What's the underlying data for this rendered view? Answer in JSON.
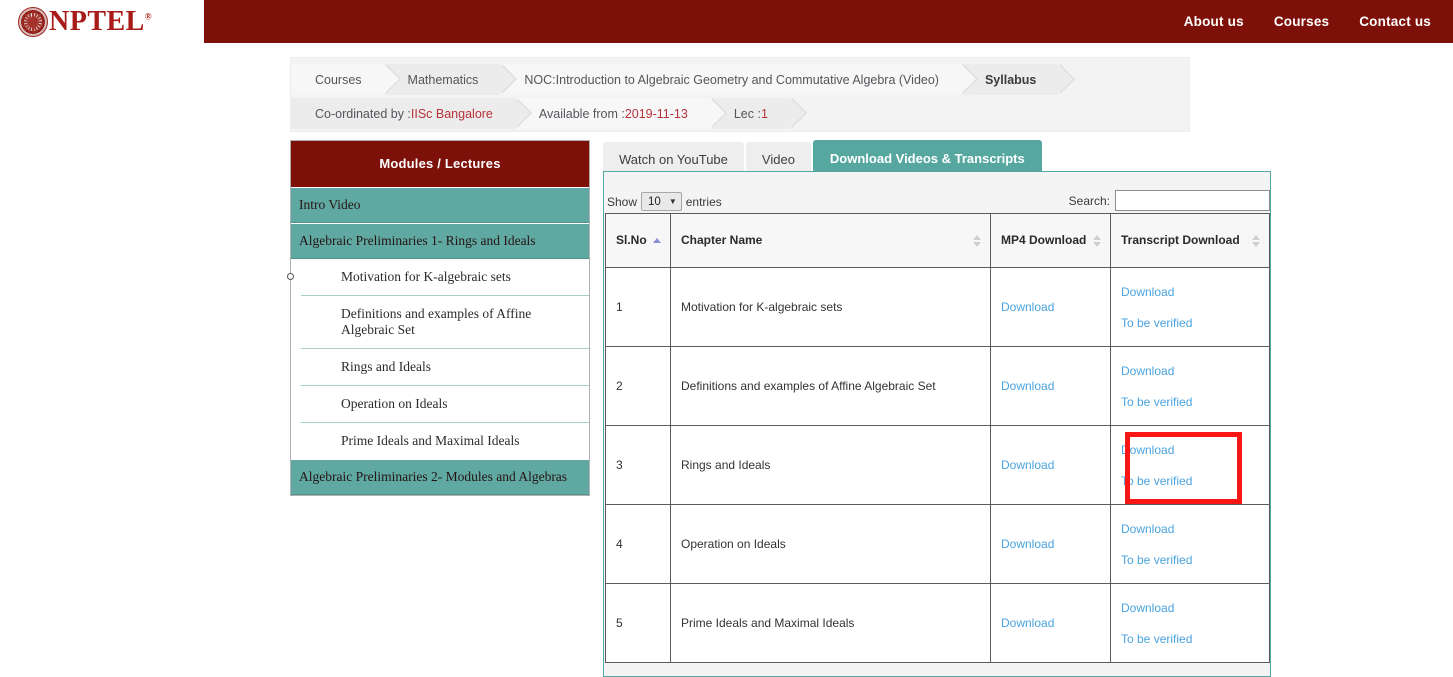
{
  "brand": {
    "logo_text": "NPTEL",
    "logo_trademark": "®",
    "bar_color": "#7d1008"
  },
  "topnav": {
    "items": [
      {
        "label": "About us"
      },
      {
        "label": "Courses"
      },
      {
        "label": "Contact us"
      }
    ]
  },
  "breadcrumb": {
    "row1": [
      {
        "label": "Courses"
      },
      {
        "label": "Mathematics"
      },
      {
        "label": "NOC:Introduction to Algebraic Geometry and Commutative Algebra (Video)"
      },
      {
        "label": "Syllabus"
      }
    ],
    "row2": [
      {
        "prefix": "Co-ordinated by : ",
        "accent": "IISc Bangalore"
      },
      {
        "prefix": "Available from : ",
        "accent": "2019-11-13"
      },
      {
        "prefix": "Lec :",
        "accent": "1"
      }
    ]
  },
  "sidebar": {
    "title": "Modules / Lectures",
    "modules": [
      {
        "label": "Intro Video"
      },
      {
        "label": "Algebraic Preliminaries 1- Rings and Ideals"
      },
      {
        "label": "Algebraic Preliminaries 2- Modules and Algebras"
      }
    ],
    "lectures": [
      {
        "label": "Motivation for K-algebraic sets",
        "active": true
      },
      {
        "label": "Definitions and examples of Affine Algebraic Set",
        "active": false
      },
      {
        "label": "Rings and Ideals",
        "active": false
      },
      {
        "label": "Operation on Ideals",
        "active": false
      },
      {
        "label": "Prime Ideals and Maximal Ideals",
        "active": false
      }
    ]
  },
  "tabs": [
    {
      "label": "Watch on YouTube",
      "active": false
    },
    {
      "label": "Video",
      "active": false
    },
    {
      "label": "Download Videos & Transcripts",
      "active": true
    }
  ],
  "datatable": {
    "show_label": "Show",
    "page_length": "10",
    "entries_label": "entries",
    "search_label": "Search:",
    "search_value": "",
    "search_placeholder": "",
    "columns": [
      {
        "label": "Sl.No",
        "sort": "asc"
      },
      {
        "label": "Chapter Name",
        "sort": "none"
      },
      {
        "label": "MP4 Download",
        "sort": "none"
      },
      {
        "label": "Transcript Download",
        "sort": "none"
      }
    ],
    "rows": [
      {
        "no": "1",
        "chapter": "Motivation for K-algebraic sets",
        "mp4": "Download",
        "transcript_download": "Download",
        "transcript_status": "To be verified",
        "highlighted": false
      },
      {
        "no": "2",
        "chapter": "Definitions and examples of Affine Algebraic Set",
        "mp4": "Download",
        "transcript_download": "Download",
        "transcript_status": "To be verified",
        "highlighted": false
      },
      {
        "no": "3",
        "chapter": "Rings and Ideals",
        "mp4": "Download",
        "transcript_download": "Download",
        "transcript_status": "To be verified",
        "highlighted": true
      },
      {
        "no": "4",
        "chapter": "Operation on Ideals",
        "mp4": "Download",
        "transcript_download": "Download",
        "transcript_status": "To be verified",
        "highlighted": false
      },
      {
        "no": "5",
        "chapter": "Prime Ideals and Maximal Ideals",
        "mp4": "Download",
        "transcript_download": "Download",
        "transcript_status": "To be verified",
        "highlighted": false
      }
    ]
  },
  "colors": {
    "maroon": "#7d1008",
    "teal": "#60a9a2",
    "link_blue": "#4aa3df",
    "highlight_red": "#fb1616",
    "accent_red": "#b7323a"
  }
}
